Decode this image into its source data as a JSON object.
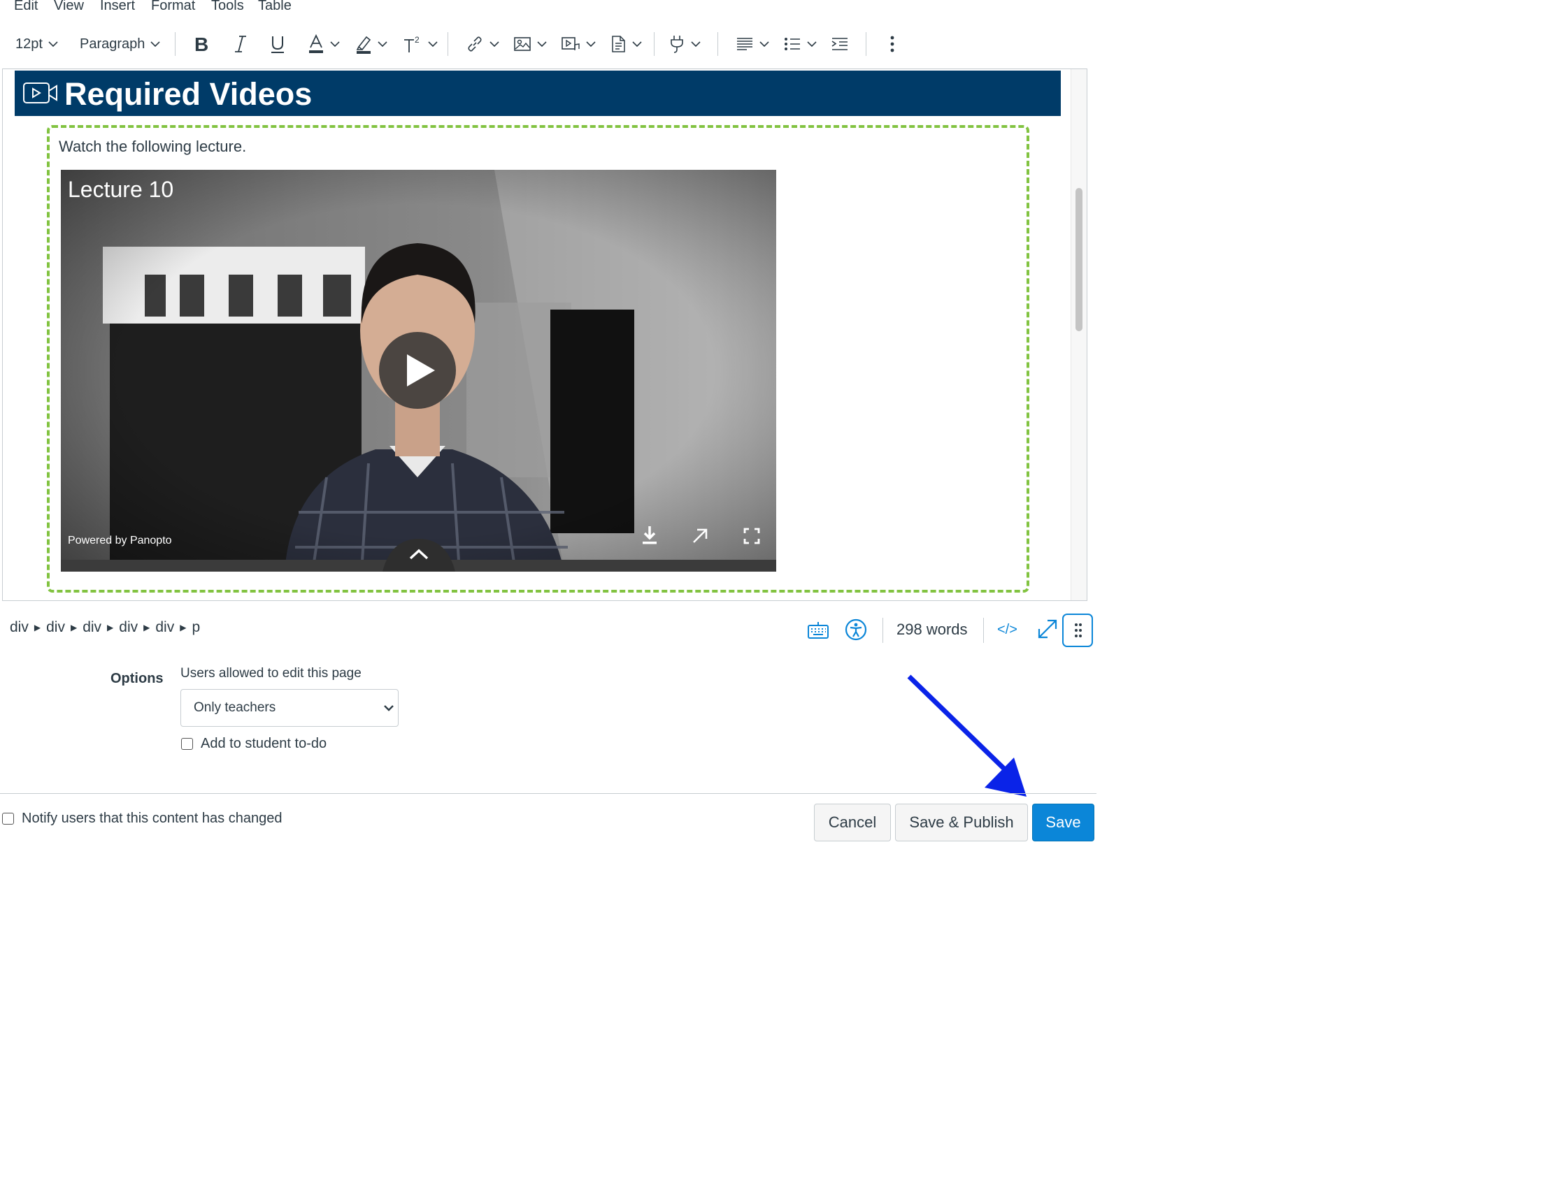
{
  "menubar": {
    "items": [
      "Edit",
      "View",
      "Insert",
      "Format",
      "Tools",
      "Table"
    ]
  },
  "toolbar": {
    "font_size": "12pt",
    "block_format": "Paragraph"
  },
  "editor": {
    "banner_title": "Required Videos",
    "intro_text": "Watch the following lecture.",
    "video": {
      "title": "Lecture 10",
      "powered_by": "Powered by Panopto"
    }
  },
  "statusbar": {
    "path": [
      "div",
      "div",
      "div",
      "div",
      "div",
      "p"
    ],
    "word_count": "298 words",
    "html_toggle": "</>"
  },
  "options": {
    "label": "Options",
    "edit_permission_label": "Users allowed to edit this page",
    "edit_permission_value": "Only teachers",
    "todo_label": "Add to student to-do"
  },
  "footer": {
    "notify_label": "Notify users that this content has changed",
    "cancel": "Cancel",
    "save_publish": "Save & Publish",
    "save": "Save"
  },
  "colors": {
    "banner": "#003b68",
    "accent": "#0b86d8",
    "dashed": "#82c341",
    "annotation_arrow": "#0a23e8"
  }
}
